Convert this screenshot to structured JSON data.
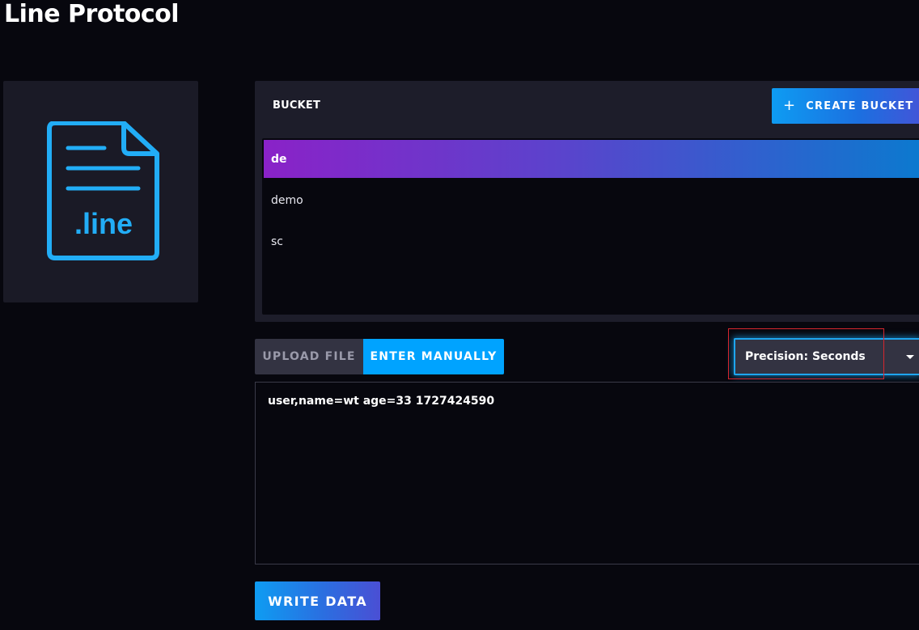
{
  "page": {
    "title": "Line Protocol"
  },
  "file_icon": {
    "name": "line-file-icon",
    "label": ".line",
    "color": "#22adf6"
  },
  "bucket": {
    "header_label": "BUCKET",
    "create_button_label": "CREATE BUCKET",
    "create_button_icon": "plus-icon",
    "items": [
      {
        "label": "de",
        "selected": true
      },
      {
        "label": "demo",
        "selected": false
      },
      {
        "label": "sc",
        "selected": false
      }
    ]
  },
  "tabs": {
    "upload_label": "UPLOAD FILE",
    "manual_label": "ENTER MANUALLY",
    "active": "ENTER MANUALLY"
  },
  "precision": {
    "selected_label": "Precision: Seconds",
    "icon": "caret-down-icon"
  },
  "editor": {
    "value": "user,name=wt age=33 1727424590"
  },
  "actions": {
    "write_label": "WRITE DATA"
  },
  "colors": {
    "background": "#07070e",
    "panel": "#1d1d2a",
    "accent_blue": "#00a3ff",
    "selected_gradient_start": "#8a22c8",
    "selected_gradient_end": "#0c79cf",
    "highlight_red": "#d6262e"
  }
}
